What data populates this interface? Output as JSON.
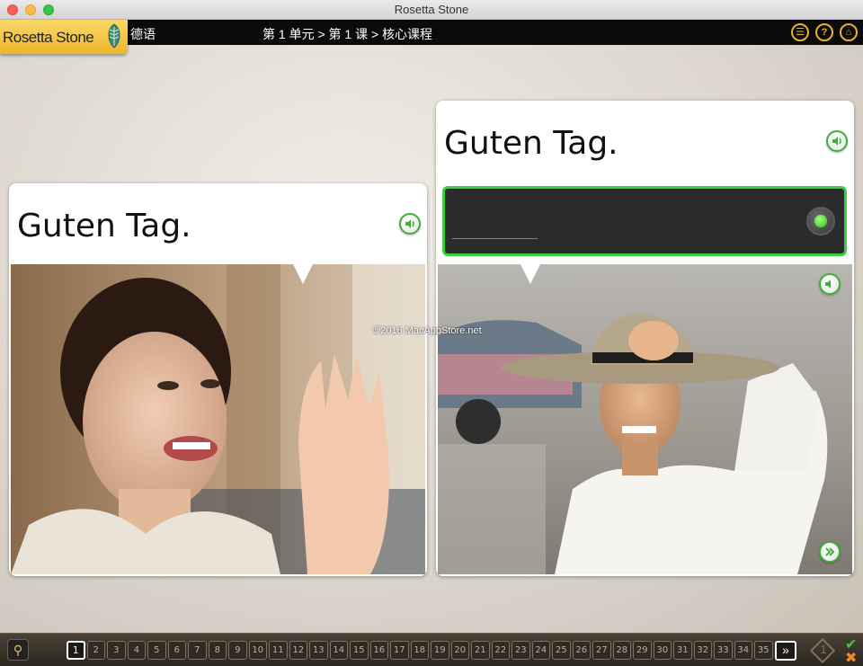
{
  "window": {
    "title": "Rosetta Stone"
  },
  "header": {
    "logo_text": "Rosetta Stone",
    "language": "德语",
    "breadcrumb": "第 1 单元 > 第 1 课 > 核心课程",
    "buttons": [
      {
        "name": "menu-icon"
      },
      {
        "name": "help-icon"
      },
      {
        "name": "home-icon"
      }
    ]
  },
  "cards": {
    "left": {
      "phrase": "Guten Tag."
    },
    "right": {
      "phrase": "Guten Tag."
    }
  },
  "watermark": "©2016 MacAppStore.net",
  "pagination": {
    "pages": [
      "1",
      "2",
      "3",
      "4",
      "5",
      "6",
      "7",
      "8",
      "9",
      "10",
      "11",
      "12",
      "13",
      "14",
      "15",
      "16",
      "17",
      "18",
      "19",
      "20",
      "21",
      "22",
      "23",
      "24",
      "25",
      "26",
      "27",
      "28",
      "29",
      "30",
      "31",
      "32",
      "33",
      "34",
      "35"
    ],
    "active_page": "1",
    "next_label": "»",
    "score_count": "1"
  },
  "colors": {
    "accent_green": "#3bd03c",
    "brand_gold": "#efb62a",
    "correct": "#46c43a",
    "incorrect": "#f08a24"
  }
}
